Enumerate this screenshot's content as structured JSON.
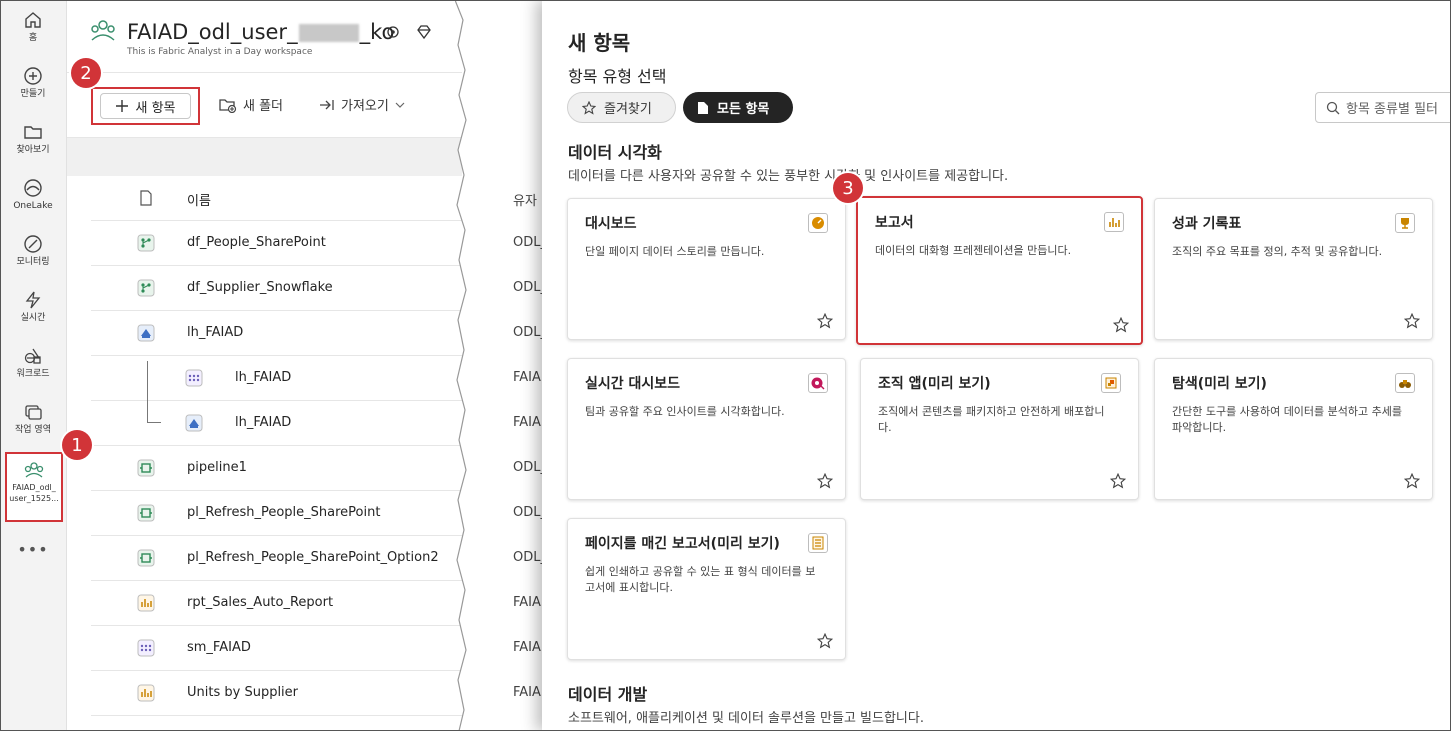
{
  "rail": {
    "items": [
      {
        "label": "홈",
        "icon": "home-icon"
      },
      {
        "label": "만들기",
        "icon": "create-icon"
      },
      {
        "label": "찾아보기",
        "icon": "browse-icon"
      },
      {
        "label": "OneLake",
        "icon": "onelake-icon"
      },
      {
        "label": "모니터링",
        "icon": "monitor-icon"
      },
      {
        "label": "실시간",
        "icon": "realtime-icon"
      },
      {
        "label": "워크로드",
        "icon": "workload-icon"
      },
      {
        "label": "작업 영역",
        "icon": "workspaces-icon"
      }
    ],
    "workspace_label_line1": "FAIAD_odl_",
    "workspace_label_line2": "user_1525...",
    "more": "•••"
  },
  "workspace": {
    "title_start": "FAIAD_odl_user_",
    "title_end": "_ko",
    "subtitle": "This is Fabric Analyst in a Day workspace",
    "toolbar": {
      "new_item": "새 항목",
      "new_folder": "새 폴더",
      "import": "가져오기"
    },
    "list_header": "이름",
    "owner_header": "유자",
    "rows": [
      {
        "name": "df_People_SharePoint",
        "owner": "ODL_U"
      },
      {
        "name": "df_Supplier_Snowflake",
        "owner": "ODL_U"
      },
      {
        "name": "lh_FAIAD",
        "owner": "ODL_U"
      },
      {
        "name": "lh_FAIAD",
        "owner": "FAIAD_"
      },
      {
        "name": "lh_FAIAD",
        "owner": "FAIAD_"
      },
      {
        "name": "pipeline1",
        "owner": "ODL_U"
      },
      {
        "name": "pl_Refresh_People_SharePoint",
        "owner": "ODL_U"
      },
      {
        "name": "pl_Refresh_People_SharePoint_Option2",
        "owner": "ODL_U"
      },
      {
        "name": "rpt_Sales_Auto_Report",
        "owner": "FAIAD_"
      },
      {
        "name": "sm_FAIAD",
        "owner": "FAIAD_"
      },
      {
        "name": "Units by Supplier",
        "owner": "FAIAD_"
      }
    ]
  },
  "drawer": {
    "title": "새 항목",
    "subtitle": "항목 유형 선택",
    "favorites": "즐겨찾기",
    "all_items": "모든 항목",
    "filter_placeholder": "항목 종류별 필터",
    "section1": {
      "title": "데이터 시각화",
      "desc": "데이터를 다른 사용자와 공유할 수 있는 풍부한 시각화 및 인사이트를 제공합니다."
    },
    "cards": [
      {
        "title": "대시보드",
        "desc": "단일 페이지 데이터 스토리를 만듭니다.",
        "icon": "dashboard-icon"
      },
      {
        "title": "보고서",
        "desc": "데이터의 대화형 프레젠테이션을 만듭니다.",
        "icon": "report-icon"
      },
      {
        "title": "성과 기록표",
        "desc": "조직의 주요 목표를 정의, 추적 및 공유합니다.",
        "icon": "scorecard-icon"
      },
      {
        "title": "실시간 대시보드",
        "desc": "팀과 공유할 주요 인사이트를 시각화합니다.",
        "icon": "realtime-dashboard-icon"
      },
      {
        "title": "조직 앱(미리 보기)",
        "desc": "조직에서 콘텐츠를 패키지하고 안전하게 배포합니다.",
        "icon": "org-app-icon"
      },
      {
        "title": "탐색(미리 보기)",
        "desc": "간단한 도구를 사용하여 데이터를 분석하고 추세를 파악합니다.",
        "icon": "exploration-icon"
      },
      {
        "title": "페이지를 매긴 보고서(미리 보기)",
        "desc": "쉽게 인쇄하고 공유할 수 있는 표 형식 데이터를 보고서에 표시합니다.",
        "icon": "paginated-report-icon"
      }
    ],
    "section2": {
      "title": "데이터 개발",
      "desc": "소프트웨어, 애플리케이션 및 데이터 솔루션을 만들고 빌드합니다."
    }
  },
  "badges": [
    "1",
    "2",
    "3"
  ],
  "colors": {
    "highlight": "#d13438",
    "pill_dark": "#242424"
  }
}
